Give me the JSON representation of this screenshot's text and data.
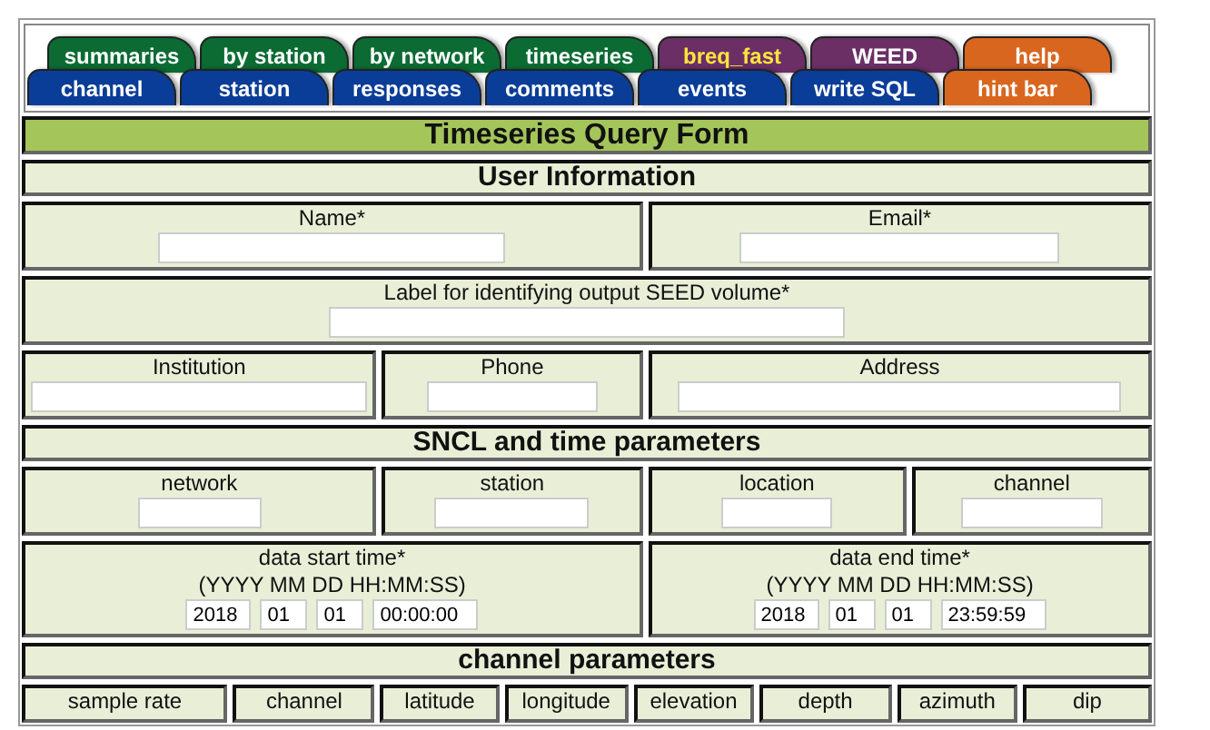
{
  "tabs": {
    "top": [
      {
        "label": "summaries",
        "color": "#0b6b33",
        "selected": false
      },
      {
        "label": "by station",
        "color": "#0b6b33",
        "selected": false
      },
      {
        "label": "by network",
        "color": "#0b6b33",
        "selected": false
      },
      {
        "label": "timeseries",
        "color": "#0b6b33",
        "selected": false
      },
      {
        "label": "breq_fast",
        "color": "#6b2f66",
        "selected": true
      },
      {
        "label": "WEED",
        "color": "#6b2f66",
        "selected": false
      },
      {
        "label": "help",
        "color": "#d9661f",
        "selected": false
      }
    ],
    "bottom": [
      {
        "label": "channel",
        "color": "#0a3d97",
        "selected": false
      },
      {
        "label": "station",
        "color": "#0a3d97",
        "selected": false
      },
      {
        "label": "responses",
        "color": "#0a3d97",
        "selected": false
      },
      {
        "label": "comments",
        "color": "#0a3d97",
        "selected": false
      },
      {
        "label": "events",
        "color": "#0a3d97",
        "selected": false
      },
      {
        "label": "write SQL",
        "color": "#0a3d97",
        "selected": false
      },
      {
        "label": "hint bar",
        "color": "#d9661f",
        "selected": false
      }
    ]
  },
  "form": {
    "title": "Timeseries Query Form",
    "sections": [
      {
        "heading": "User Information",
        "rows": [
          [
            {
              "label": "Name*",
              "colspan": 2,
              "input": true
            },
            {
              "label": "Email*",
              "input": true
            }
          ],
          [
            {
              "label": "Label for identifying output SEED volume*",
              "colspan": 3,
              "input": true
            }
          ],
          [
            {
              "label": "Institution",
              "input": true
            },
            {
              "label": "Phone",
              "input": true
            },
            {
              "label": "Address",
              "input": true
            }
          ]
        ]
      },
      {
        "heading": "SNCL and time parameters",
        "rows": [
          [
            {
              "label": "network",
              "input": true
            },
            {
              "label": "station",
              "input": true
            },
            {
              "label": "location",
              "input": true
            },
            {
              "label": "channel",
              "input": true
            }
          ],
          [
            {
              "label": "data start time*",
              "colspan": 2,
              "hint": "(YYYY MM DD HH:MM:SS)",
              "values": [
                "2018",
                "01",
                "01",
                "00:00:00"
              ]
            },
            {
              "label": "data end time*",
              "colspan": 2,
              "hint": "(YYYY MM DD HH:MM:SS)",
              "values": [
                "2018",
                "01",
                "01",
                "23:59:59"
              ]
            }
          ]
        ]
      },
      {
        "heading": "channel parameters",
        "rows": [
          [
            {
              "label": "sample rate"
            },
            {
              "label": "channel"
            },
            {
              "label": "latitude"
            },
            {
              "label": "longitude"
            },
            {
              "label": "elevation"
            },
            {
              "label": "depth"
            },
            {
              "label": "azimuth"
            },
            {
              "label": "dip"
            }
          ]
        ]
      }
    ]
  }
}
